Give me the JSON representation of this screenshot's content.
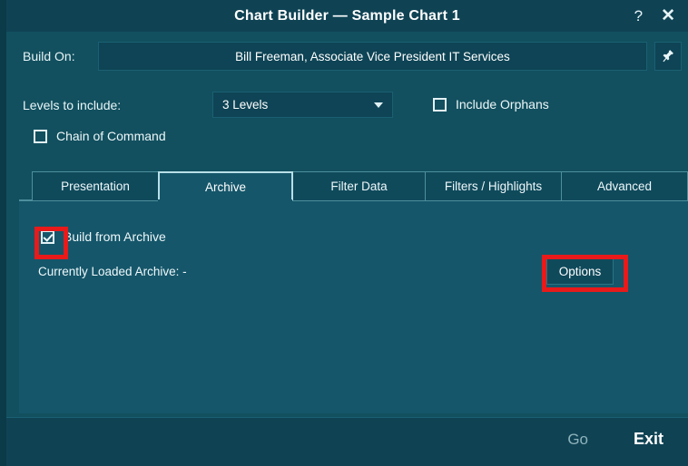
{
  "window": {
    "title": "Chart Builder — Sample Chart 1",
    "help_label": "?",
    "close_label": "✕"
  },
  "build_on": {
    "label": "Build On:",
    "value": "Bill Freeman, Associate Vice President IT Services",
    "pin_icon": "pushpin-icon"
  },
  "levels": {
    "label": "Levels to include:",
    "selected": "3 Levels",
    "options": [
      "3 Levels"
    ],
    "caret_icon": "chevron-down-icon"
  },
  "options_checkboxes": {
    "include_orphans": {
      "label": "Include Orphans",
      "checked": false
    },
    "chain_of_command": {
      "label": "Chain of Command",
      "checked": false
    }
  },
  "tabs": [
    {
      "label": "Presentation",
      "active": false
    },
    {
      "label": "Archive",
      "active": true
    },
    {
      "label": "Filter Data",
      "active": false
    },
    {
      "label": "Filters / Highlights",
      "active": false
    },
    {
      "label": "Advanced",
      "active": false
    }
  ],
  "archive_panel": {
    "build_from_archive": {
      "label": "Build from Archive",
      "checked": true
    },
    "currently_loaded_archive": "Currently Loaded Archive: -",
    "options_button": "Options"
  },
  "footer": {
    "go_label": "Go",
    "exit_label": "Exit"
  },
  "annotations": {
    "highlight_color": "#e81a1a",
    "boxes": [
      "build-from-archive-checkbox",
      "options-button"
    ]
  },
  "colors": {
    "window_background": "#12505f",
    "titlebar": "#0f4354",
    "panel": "#15566a",
    "field": "#0e4455",
    "accent_border": "#4e8f9d",
    "text": "#eaf6f8",
    "left_edge": "#0b3a48"
  }
}
